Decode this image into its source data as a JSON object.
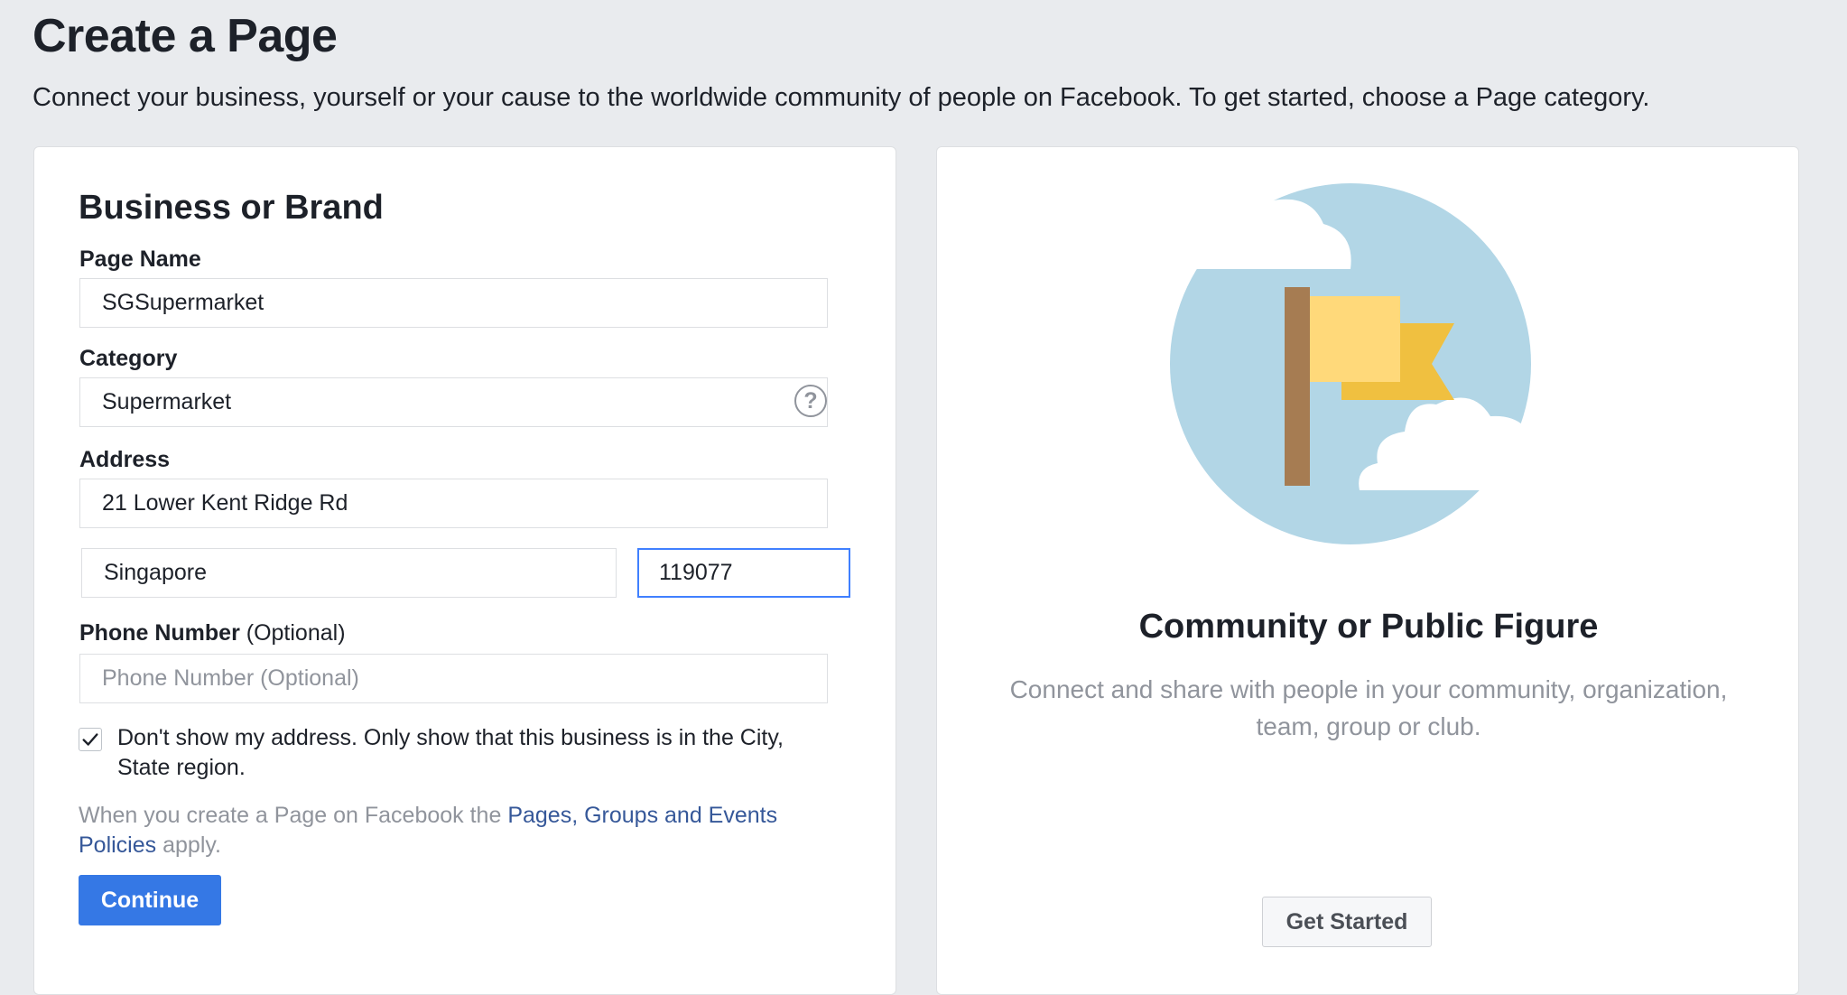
{
  "header": {
    "title": "Create a Page",
    "subtitle": "Connect your business, yourself or your cause to the worldwide community of people on Facebook. To get started, choose a Page category."
  },
  "business_card": {
    "title": "Business or Brand",
    "page_name": {
      "label": "Page Name",
      "value": "SGSupermarket"
    },
    "category": {
      "label": "Category",
      "value": "Supermarket",
      "help_icon": "question-circle-icon"
    },
    "address": {
      "label": "Address",
      "street": "21 Lower Kent Ridge Rd",
      "city": "Singapore",
      "zip": "119077"
    },
    "phone": {
      "label": "Phone Number",
      "label_optional": "(Optional)",
      "placeholder": "Phone Number (Optional)",
      "value": ""
    },
    "hide_address": {
      "checked": true,
      "label": "Don't show my address. Only show that this business is in the City, State region."
    },
    "policy": {
      "prefix": "When you create a Page on Facebook the ",
      "link": "Pages, Groups and Events Policies",
      "suffix": " apply."
    },
    "continue_label": "Continue"
  },
  "community_card": {
    "title": "Community or Public Figure",
    "description": "Connect and share with people in your community, organization, team, group or club.",
    "button_label": "Get Started",
    "illustration": "flag-illustration"
  },
  "colors": {
    "background": "#e9ebee",
    "primary_button": "#3578e5",
    "link": "#365899",
    "muted_text": "#90949c",
    "focus_border": "#4080ff"
  }
}
